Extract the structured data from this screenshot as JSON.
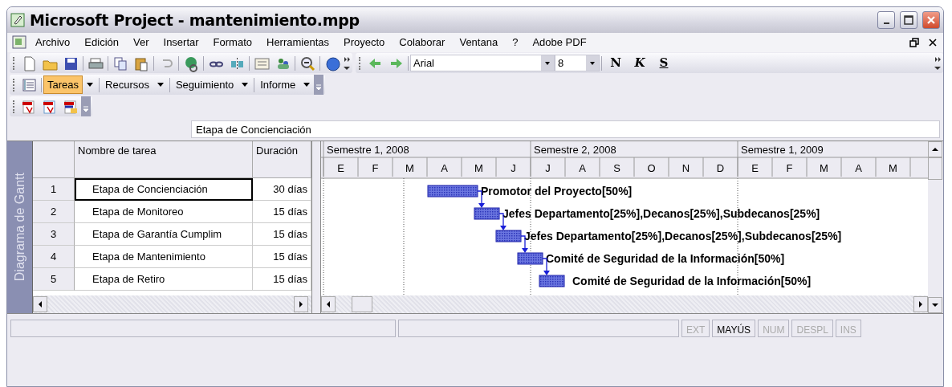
{
  "window": {
    "title": "Microsoft Project - mantenimiento.mpp"
  },
  "menu": [
    {
      "label": "Archivo"
    },
    {
      "label": "Edición"
    },
    {
      "label": "Ver"
    },
    {
      "label": "Insertar"
    },
    {
      "label": "Formato"
    },
    {
      "label": "Herramientas"
    },
    {
      "label": "Proyecto"
    },
    {
      "label": "Colaborar"
    },
    {
      "label": "Ventana"
    },
    {
      "label": "?"
    },
    {
      "label": "Adobe PDF"
    }
  ],
  "format_toolbar": {
    "font": "Arial",
    "size": "8",
    "buttons": [
      "N",
      "K",
      "S"
    ]
  },
  "views_toolbar": [
    {
      "label": "Tareas",
      "selected": true
    },
    {
      "label": "Recursos",
      "selected": false
    },
    {
      "label": "Seguimiento",
      "selected": false
    },
    {
      "label": "Informe",
      "selected": false
    }
  ],
  "entry_bar": {
    "value": "Etapa de Concienciación"
  },
  "side_tab": "Diagrama de Gantt",
  "table": {
    "columns": [
      "Nombre de tarea",
      "Duración"
    ],
    "rows": [
      {
        "id": "1",
        "name": "Etapa de Concienciación",
        "duration": "30 días",
        "selected": true
      },
      {
        "id": "2",
        "name": "Etapa de Monitoreo",
        "duration": "15 días",
        "selected": false
      },
      {
        "id": "3",
        "name": "Etapa de Garantía Cumplim",
        "duration": "15 días",
        "selected": false
      },
      {
        "id": "4",
        "name": "Etapa de Mantenimiento",
        "duration": "15 días",
        "selected": false
      },
      {
        "id": "5",
        "name": "Etapa de Retiro",
        "duration": "15 días",
        "selected": false
      }
    ]
  },
  "gantt": {
    "timescale": [
      {
        "label": "Semestre 1, 2008",
        "months": [
          "E",
          "F",
          "M",
          "A",
          "M",
          "J"
        ]
      },
      {
        "label": "Semestre 2, 2008",
        "months": [
          "J",
          "A",
          "S",
          "O",
          "N",
          "D"
        ]
      },
      {
        "label": "Semestre 1, 2009",
        "months": [
          "E",
          "F",
          "M",
          "A",
          "M"
        ]
      }
    ],
    "bars": [
      {
        "resources": "Promotor del Proyecto[50%]"
      },
      {
        "resources": "Jefes Departamento[25%],Decanos[25%],Subdecanos[25%]"
      },
      {
        "resources": "Jefes Departamento[25%],Decanos[25%],Subdecanos[25%]"
      },
      {
        "resources": "Comité de Seguridad de la Información[50%]"
      },
      {
        "resources": "Comité de Seguridad de la Información[50%]"
      }
    ]
  },
  "status_bar": [
    {
      "label": "EXT",
      "on": false
    },
    {
      "label": "MAYÚS",
      "on": true
    },
    {
      "label": "NUM",
      "on": false
    },
    {
      "label": "DESPL",
      "on": false
    },
    {
      "label": "INS",
      "on": false
    }
  ]
}
